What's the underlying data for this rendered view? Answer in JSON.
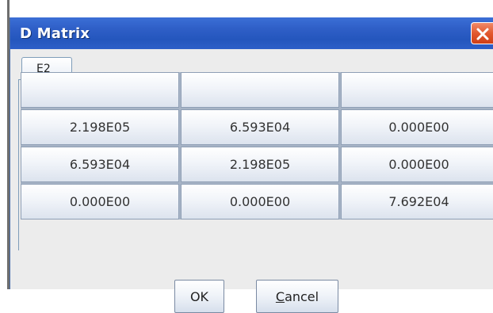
{
  "window": {
    "title": "D Matrix"
  },
  "tabs": [
    {
      "label": "E2"
    }
  ],
  "matrix": {
    "header": [
      "",
      "",
      ""
    ],
    "rows": [
      [
        "2.198E05",
        "6.593E04",
        "0.000E00"
      ],
      [
        "6.593E04",
        "2.198E05",
        "0.000E00"
      ],
      [
        "0.000E00",
        "0.000E00",
        "7.692E04"
      ]
    ]
  },
  "buttons": {
    "ok": "OK",
    "cancel_mnemonic": "C",
    "cancel_rest": "ancel"
  },
  "icons": {
    "close": "close-icon"
  },
  "colors": {
    "titlebar": "#2456bd",
    "close": "#e3582f"
  }
}
